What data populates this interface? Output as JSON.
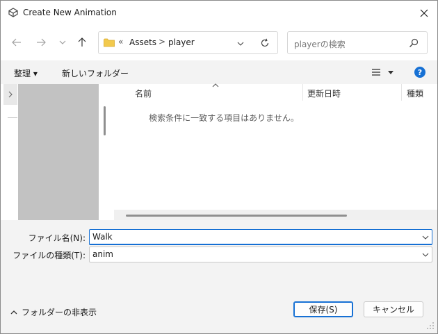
{
  "window": {
    "title": "Create New Animation",
    "close_icon": "close-icon"
  },
  "nav": {
    "back_icon": "arrow-left-icon",
    "forward_icon": "arrow-right-icon",
    "recent_icon": "chevron-down-icon",
    "up_icon": "arrow-up-icon"
  },
  "address": {
    "overflow": "«",
    "crumbs": [
      "Assets",
      "player"
    ],
    "separator": ">"
  },
  "search": {
    "placeholder": "playerの検索"
  },
  "toolbar": {
    "organize_label": "整理 ▾",
    "new_folder_label": "新しいフォルダー",
    "help_label": "?"
  },
  "list": {
    "columns": [
      "名前",
      "更新日時",
      "種類"
    ],
    "empty_message": "検索条件に一致する項目はありません。"
  },
  "fields": {
    "filename_label": "ファイル名(N):",
    "filename_value": "Walk",
    "filetype_label": "ファイルの種類(T):",
    "filetype_value": "anim"
  },
  "footer": {
    "hide_folders_label": "フォルダーの非表示",
    "save_label": "保存(S)",
    "cancel_label": "キャンセル"
  },
  "colors": {
    "accent": "#1670d4",
    "nav_pane_gray": "#c2c2c2",
    "folder": "#f2c94c"
  }
}
